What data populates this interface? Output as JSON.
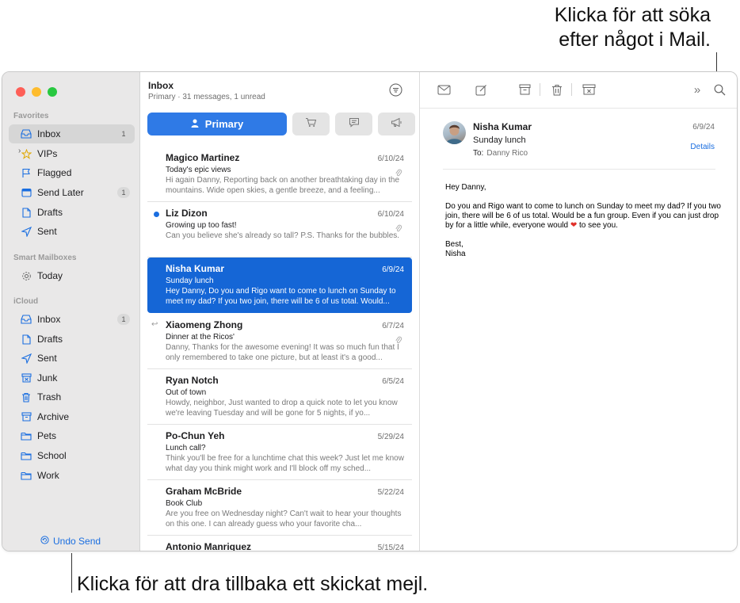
{
  "callouts": {
    "top_line1": "Klicka för att söka",
    "top_line2": "efter något i Mail.",
    "bottom": "Klicka för att dra tillbaka ett skickat mejl."
  },
  "sidebar": {
    "favorites_title": "Favorites",
    "favorites": [
      {
        "label": "Inbox",
        "badge": "1",
        "icon": "tray-icon"
      },
      {
        "label": "VIPs",
        "icon": "star-icon"
      },
      {
        "label": "Flagged",
        "icon": "flag-icon"
      },
      {
        "label": "Send Later",
        "badge": "1",
        "icon": "calendar-icon"
      },
      {
        "label": "Drafts",
        "icon": "document-icon"
      },
      {
        "label": "Sent",
        "icon": "paperplane-icon"
      }
    ],
    "smart_title": "Smart Mailboxes",
    "smart": [
      {
        "label": "Today",
        "icon": "gear-icon"
      }
    ],
    "icloud_title": "iCloud",
    "icloud": [
      {
        "label": "Inbox",
        "badge": "1",
        "icon": "tray-icon"
      },
      {
        "label": "Drafts",
        "icon": "document-icon"
      },
      {
        "label": "Sent",
        "icon": "paperplane-icon"
      },
      {
        "label": "Junk",
        "icon": "junk-icon"
      },
      {
        "label": "Trash",
        "icon": "trash-icon"
      },
      {
        "label": "Archive",
        "icon": "archive-icon"
      },
      {
        "label": "Pets",
        "icon": "folder-icon"
      },
      {
        "label": "School",
        "icon": "folder-icon"
      },
      {
        "label": "Work",
        "icon": "folder-icon"
      }
    ],
    "undo_send": "Undo Send"
  },
  "list": {
    "title": "Inbox",
    "subtitle": "Primary · 31 messages, 1 unread",
    "primary_tab": "Primary",
    "messages": [
      {
        "sender": "Magico Martinez",
        "date": "6/10/24",
        "subject": "Today's epic views",
        "preview": "Hi again Danny, Reporting back on another breathtaking day in the mountains. Wide open skies, a gentle breeze, and a feeling..."
      },
      {
        "sender": "Liz Dizon",
        "date": "6/10/24",
        "subject": "Growing up too fast!",
        "preview": "Can you believe she's already so tall? P.S. Thanks for the bubbles."
      },
      {
        "sender": "Nisha Kumar",
        "date": "6/9/24",
        "subject": "Sunday lunch",
        "preview": "Hey Danny, Do you and Rigo want to come to lunch on Sunday to meet my dad? If you two join, there will be 6 of us total. Would..."
      },
      {
        "sender": "Xiaomeng Zhong",
        "date": "6/7/24",
        "subject": "Dinner at the Ricos'",
        "preview": "Danny, Thanks for the awesome evening! It was so much fun that I only remembered to take one picture, but at least it's a good..."
      },
      {
        "sender": "Ryan Notch",
        "date": "6/5/24",
        "subject": "Out of town",
        "preview": "Howdy, neighbor, Just wanted to drop a quick note to let you know we're leaving Tuesday and will be gone for 5 nights, if yo..."
      },
      {
        "sender": "Po-Chun Yeh",
        "date": "5/29/24",
        "subject": "Lunch call?",
        "preview": "Think you'll be free for a lunchtime chat this week? Just let me know what day you think might work and I'll block off my sched..."
      },
      {
        "sender": "Graham McBride",
        "date": "5/22/24",
        "subject": "Book Club",
        "preview": "Are you free on Wednesday night? Can't wait to hear your thoughts on this one. I can already guess who your favorite cha..."
      },
      {
        "sender": "Antonio Manriquez",
        "date": "5/15/24",
        "subject": "",
        "preview": ""
      }
    ]
  },
  "reader": {
    "from": "Nisha Kumar",
    "subject": "Sunday lunch",
    "to_label": "To:",
    "to": "Danny Rico",
    "date": "6/9/24",
    "details": "Details",
    "greeting": "Hey Danny,",
    "body_line": "Do you and Rigo want to come to lunch on Sunday to meet my dad? If you two join, there will be 6 of us total. Would be a fun group. Even if you can just drop by for a little while, everyone would",
    "body_end": " to see you.",
    "signoff": "Best,",
    "signature": "Nisha"
  },
  "colors": {
    "accent": "#1a6ee0",
    "selected_row": "#1566d6",
    "sidebar_bg": "#e9e8e8",
    "close": "#fe5f57",
    "minimize": "#febc2e",
    "zoom": "#28c840"
  }
}
